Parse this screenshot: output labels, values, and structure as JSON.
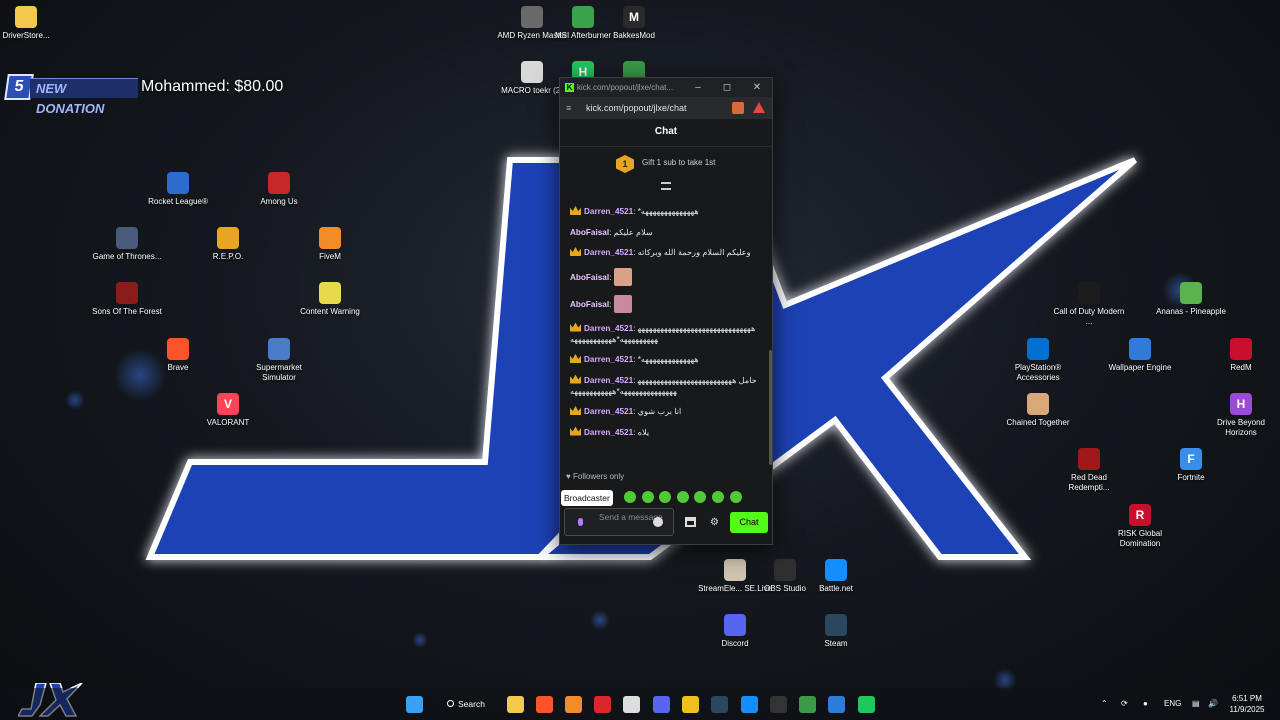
{
  "desktop_icons": [
    {
      "label": "DriverStore...",
      "icon": "folder-icon",
      "color": "#f2c94c"
    },
    {
      "label": "AMD Ryzen Master",
      "icon": "amd-ryzen-master-icon",
      "color": "#6a6a6a"
    },
    {
      "label": "MSI Afterburner",
      "icon": "msi-afterburner-icon",
      "color": "#3aa24a"
    },
    {
      "label": "BakkesMod",
      "icon": "bakkesmod-icon",
      "color": "#2a2a2a"
    },
    {
      "label": "MACRO toekr (2)",
      "icon": "file-icon",
      "color": "#d8d8d8"
    },
    {
      "label": "Rocket League®",
      "icon": "rocket-league-icon",
      "color": "#2d6ccf"
    },
    {
      "label": "Among Us",
      "icon": "among-us-icon",
      "color": "#c62828"
    },
    {
      "label": "Game of Thrones...",
      "icon": "game-of-thrones-icon",
      "color": "#4a5a7a"
    },
    {
      "label": "R.E.P.O.",
      "icon": "repo-icon",
      "color": "#e8a521"
    },
    {
      "label": "FiveM",
      "icon": "fivem-icon",
      "color": "#f28c28"
    },
    {
      "label": "Sons Of The Forest",
      "icon": "sons-of-the-forest-icon",
      "color": "#8a1c1c"
    },
    {
      "label": "Content Warning",
      "icon": "content-warning-icon",
      "color": "#e6d94a"
    },
    {
      "label": "Brave",
      "icon": "brave-icon",
      "color": "#fb542b"
    },
    {
      "label": "Supermarket Simulator",
      "icon": "supermarket-simulator-icon",
      "color": "#4a7bc8"
    },
    {
      "label": "VALORANT",
      "icon": "valorant-icon",
      "color": "#fd4556"
    },
    {
      "label": "Call of Duty Modern ...",
      "icon": "call-of-duty-icon",
      "color": "#1c1c1c"
    },
    {
      "label": "Ananas - Pineapple",
      "icon": "ananas-icon",
      "color": "#5ab34c"
    },
    {
      "label": "PlayStation® Accessories",
      "icon": "playstation-icon",
      "color": "#0070d1"
    },
    {
      "label": "Wallpaper Engine",
      "icon": "wallpaper-engine-icon",
      "color": "#2f7cd8"
    },
    {
      "label": "RedM",
      "icon": "redm-icon",
      "color": "#c8102e"
    },
    {
      "label": "Chained Together",
      "icon": "chained-together-icon",
      "color": "#d8a77a"
    },
    {
      "label": "Drive Beyond Horizons",
      "icon": "drive-beyond-horizons-icon",
      "color": "#9c4ad8"
    },
    {
      "label": "Red Dead Redempti...",
      "icon": "red-dead-icon",
      "color": "#a01818"
    },
    {
      "label": "Fortnite",
      "icon": "fortnite-icon",
      "color": "#3a8de8"
    },
    {
      "label": "RISK Global Domination",
      "icon": "risk-icon",
      "color": "#c8102e"
    },
    {
      "label": "StreamEle... SE.Live",
      "icon": "streamelements-icon",
      "color": "#d0c6b0"
    },
    {
      "label": "OBS Studio",
      "icon": "obs-studio-icon",
      "color": "#303030"
    },
    {
      "label": "Battle.net",
      "icon": "battlenet-icon",
      "color": "#148eff"
    },
    {
      "label": "Discord",
      "icon": "discord-icon",
      "color": "#5865f2"
    },
    {
      "label": "Steam",
      "icon": "steam-icon",
      "color": "#2a475e"
    },
    {
      "label": "",
      "icon": "hyper-icon",
      "color": "#22c55e"
    },
    {
      "label": "",
      "icon": "grid-app-icon",
      "color": "#3a9a4a"
    }
  ],
  "donation": {
    "badge": "5",
    "tag": "NEW DONATION",
    "text": "Mohammed: $80.00"
  },
  "browser": {
    "tab_title": "kick.com/popout/jlxe/chat...",
    "url": "kick.com/popout/jlxe/chat"
  },
  "chat": {
    "header": "Chat",
    "gift_rank": "1",
    "gift_text": "Gift 1 sub to take 1st",
    "messages": [
      {
        "user": "Darren_4521",
        "text": "*ههههههههههههههه",
        "crown": true
      },
      {
        "user": "AboFaisal",
        "text": "سلام عليكم",
        "crown": false
      },
      {
        "user": "Darren_4521",
        "text": "وعليكم السلام ورحمة الله وبركاته",
        "crown": true
      },
      {
        "user": "AboFaisal",
        "text": "",
        "crown": false,
        "emote": "#d9a08a"
      },
      {
        "user": "AboFaisal",
        "text": "",
        "crown": false,
        "emote": "#c98aa0"
      },
      {
        "user": "Darren_4521",
        "text": "ههههههههههههههههههههههههههههههههههههههههه*هههههههههههه",
        "crown": true
      },
      {
        "user": "Darren_4521",
        "text": "*ههههههههههههههه",
        "crown": true
      },
      {
        "user": "Darren_4521",
        "text": "حامل ههههههههههههههههههههههههههههههههههههههههه*هههههههههههه",
        "crown": true
      },
      {
        "user": "Darren_4521",
        "text": "انا برب شوي",
        "crown": true
      },
      {
        "user": "Darren_4521",
        "text": "يلاه",
        "crown": true
      }
    ],
    "followers_only": "Followers only",
    "tooltip": "Broadcaster",
    "input_placeholder": "Send a message",
    "send_label": "Chat"
  },
  "taskbar": {
    "search_label": "Search",
    "language": "ENG",
    "time": "6:51 PM",
    "date": "11/9/2025",
    "apps": [
      {
        "icon": "windows-start-icon",
        "color": "#3aa0f0"
      },
      {
        "icon": "file-explorer-icon",
        "color": "#f2c94c"
      },
      {
        "icon": "brave-icon",
        "color": "#fb542b"
      },
      {
        "icon": "fivem-icon",
        "color": "#f28c28"
      },
      {
        "icon": "bakkesmod-icon",
        "color": "#d8282a"
      },
      {
        "icon": "chrome-icon",
        "color": "#dddddd"
      },
      {
        "icon": "discord-icon",
        "color": "#5865f2"
      },
      {
        "icon": "fortnite-icon",
        "color": "#f0c020"
      },
      {
        "icon": "steam-icon",
        "color": "#2a475e"
      },
      {
        "icon": "battlenet-icon",
        "color": "#148eff"
      },
      {
        "icon": "epic-games-icon",
        "color": "#333333"
      },
      {
        "icon": "gpu-icon",
        "color": "#3a9a4a"
      },
      {
        "icon": "wallpaper-engine-icon",
        "color": "#2f7cd8"
      },
      {
        "icon": "hyper-icon",
        "color": "#22c55e"
      }
    ]
  },
  "colors": {
    "kick_green": "#53fc18",
    "username_purple": "#d7a9ff",
    "wallpaper_blue": "#1d43b5"
  }
}
